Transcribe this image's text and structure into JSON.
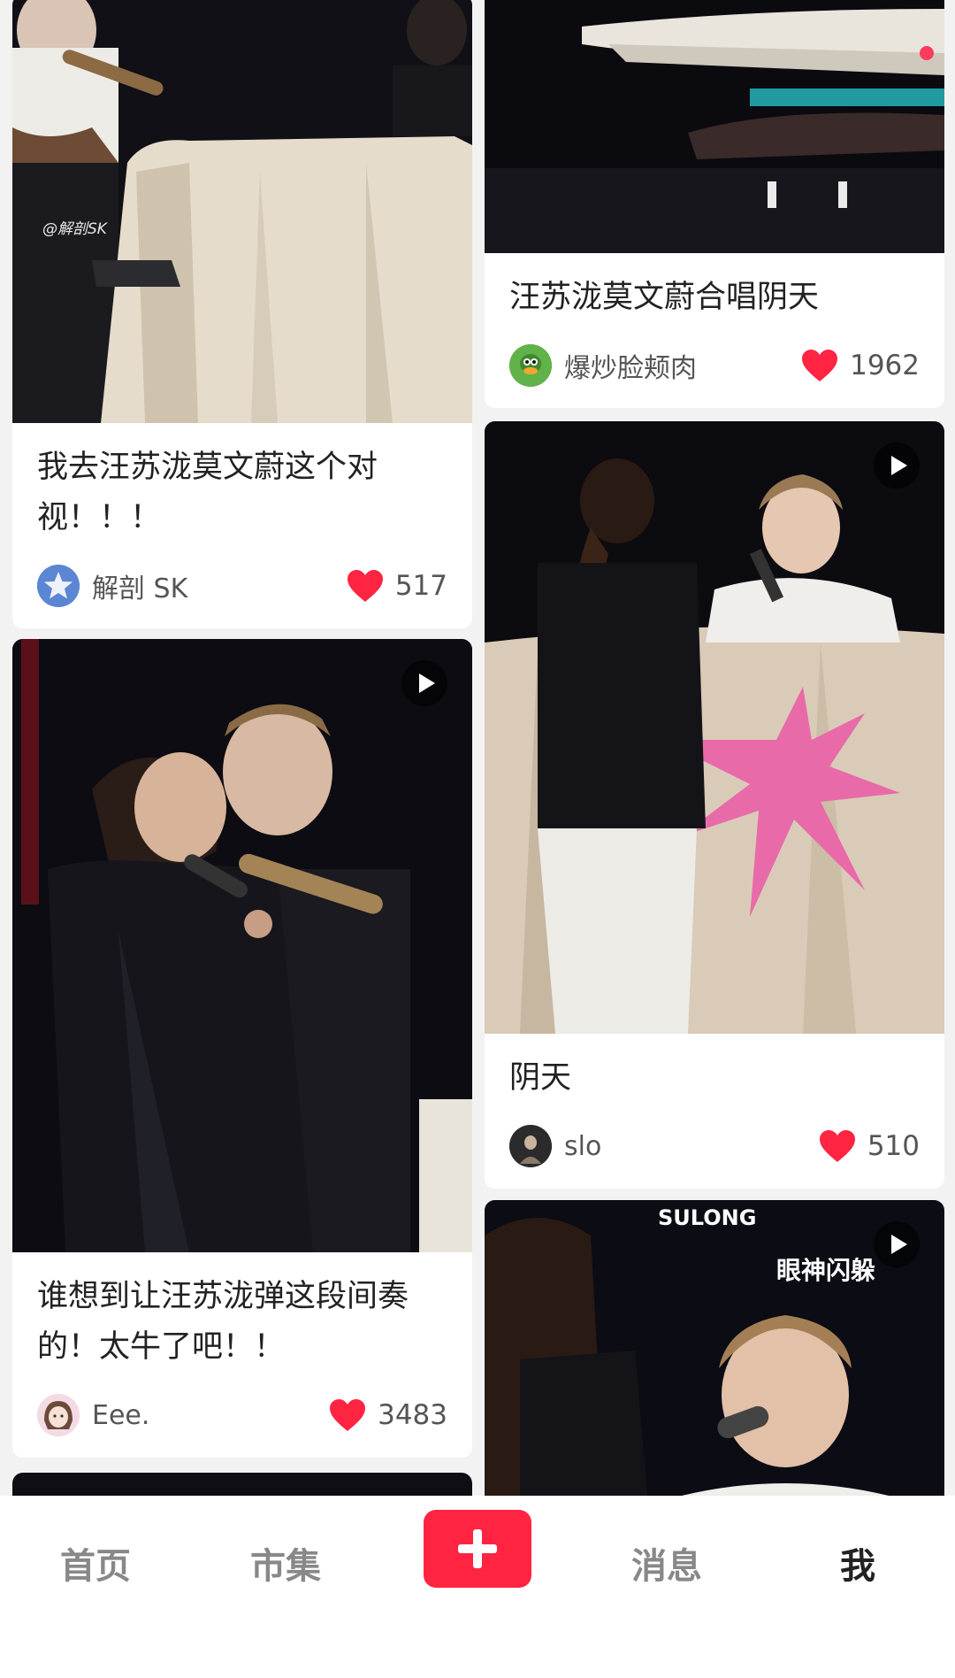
{
  "feed": {
    "left": [
      {
        "title": "我去汪苏泷莫文蔚这个对视！！！",
        "author": "解剖 SK",
        "likes": "517",
        "watermark": "@解剖SK",
        "avatar_icon": "star-avatar"
      },
      {
        "title": "谁想到让汪苏泷弹这段间奏的！太牛了吧！！",
        "author": "Eee.",
        "likes": "3483",
        "avatar_icon": "girl-avatar",
        "is_video": true
      }
    ],
    "right": [
      {
        "title": "汪苏泷莫文蔚合唱阴天",
        "author": "爆炒脸颊肉",
        "likes": "1962",
        "avatar_icon": "duck-avatar"
      },
      {
        "title": "阴天",
        "author": "slo",
        "likes": "510",
        "avatar_icon": "photo-avatar",
        "is_video": true
      },
      {
        "overlay_brand": "SULONG",
        "overlay_caption": "眼神闪躲",
        "is_video": true
      }
    ]
  },
  "nav": {
    "home": "首页",
    "market": "市集",
    "messages": "消息",
    "me": "我",
    "active": "me"
  },
  "colors": {
    "accent": "#ff2442",
    "heart": "#ff2442",
    "background": "#f2f2f2"
  }
}
